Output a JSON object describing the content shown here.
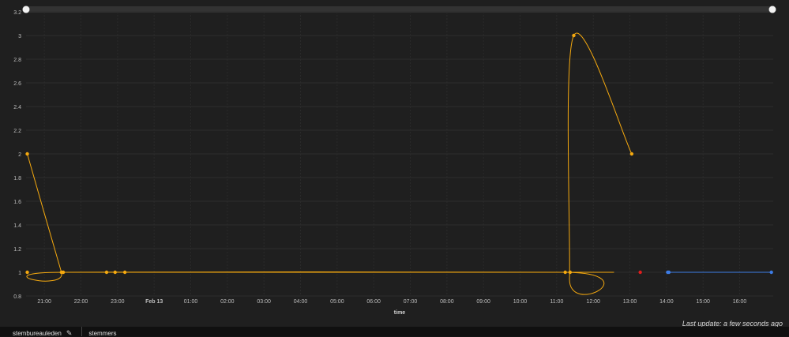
{
  "chart_data": {
    "type": "line",
    "title": "",
    "xlabel": "time",
    "ylabel": "",
    "ylim": [
      0.8,
      3.2
    ],
    "y_ticks": [
      "0.8",
      "1",
      "1.2",
      "1.4",
      "1.6",
      "1.8",
      "2",
      "2.2",
      "2.4",
      "2.6",
      "2.8",
      "3",
      "3.2"
    ],
    "x_range": [
      "Feb 12 20:30",
      "Feb 13 16:55"
    ],
    "x_ticks": [
      "21:00",
      "22:00",
      "23:00",
      "Feb 13",
      "01:00",
      "02:00",
      "03:00",
      "04:00",
      "05:00",
      "06:00",
      "07:00",
      "08:00",
      "09:00",
      "10:00",
      "11:00",
      "12:00",
      "13:00",
      "14:00",
      "15:00",
      "16:00"
    ],
    "grid": true,
    "legend": "none",
    "series": [
      {
        "color": "#f5a90f",
        "line_x": [
          "Feb 12 20:32",
          "Feb 12 21:28",
          "Feb 12 21:31",
          "Feb 13 11:15",
          "Feb 13 11:21",
          "Feb 13 11:28",
          "Feb 13 13:03"
        ],
        "line_y": [
          2,
          1,
          1,
          1,
          0.95,
          3,
          2
        ],
        "flat_segment": {
          "x": [
            "Feb 12 21:31",
            "Feb 13 12:34"
          ],
          "y": 1
        },
        "points_x": [
          "Feb 12 20:32",
          "Feb 12 20:32",
          "Feb 12 21:28",
          "Feb 12 21:31",
          "Feb 12 22:42",
          "Feb 12 22:56",
          "Feb 12 23:12",
          "Feb 13 11:14",
          "Feb 13 11:22",
          "Feb 13 11:28",
          "Feb 13 13:03"
        ],
        "points_y": [
          2,
          1,
          1,
          1,
          1,
          1,
          1,
          1,
          1,
          3,
          2
        ]
      },
      {
        "color": "#e11d1d",
        "points_x": [
          "Feb 13 13:17"
        ],
        "points_y": [
          1
        ]
      },
      {
        "color": "#3d7ce6",
        "line_x": [
          "Feb 13 14:02",
          "Feb 13 16:52"
        ],
        "line_y": [
          1,
          1
        ],
        "points_x": [
          "Feb 13 14:02",
          "Feb 13 14:04",
          "Feb 13 16:52"
        ],
        "points_y": [
          1,
          1,
          1
        ]
      }
    ]
  },
  "footer": {
    "last_update": "Last update: a few seconds ago"
  },
  "tabs": [
    {
      "label": "stembureauleden"
    },
    {
      "label": "stemmers"
    }
  ]
}
